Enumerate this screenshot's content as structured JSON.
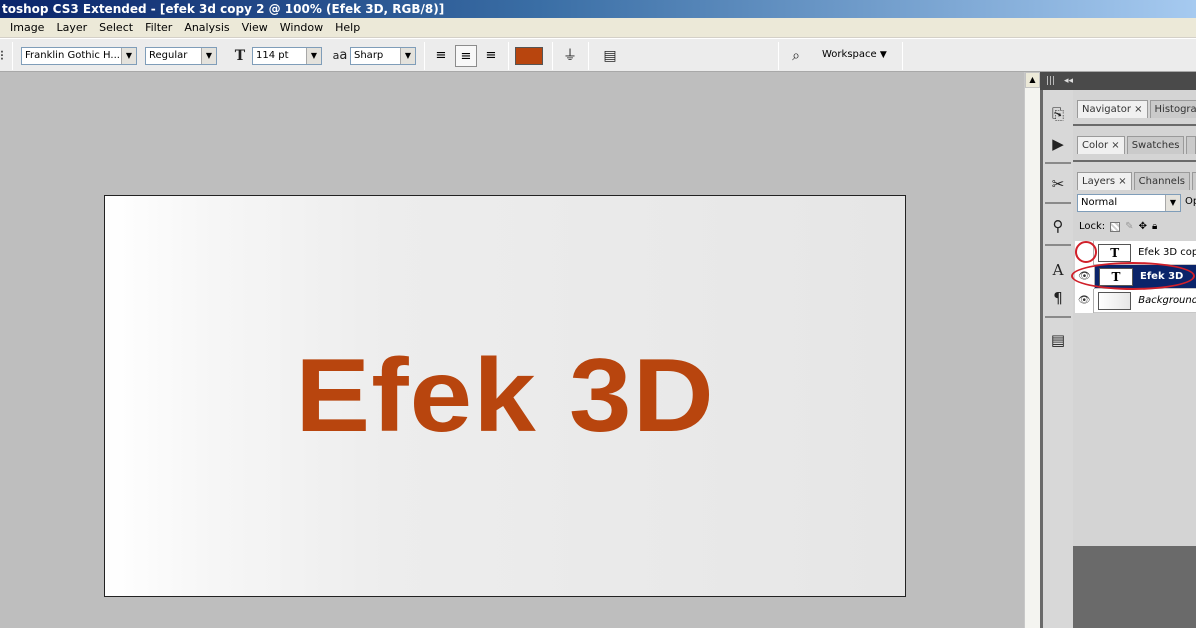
{
  "window": {
    "title": "toshop CS3 Extended - [efek 3d copy 2 @ 100% (Efek 3D, RGB/8)]"
  },
  "menu": [
    "Image",
    "Layer",
    "Select",
    "Filter",
    "Analysis",
    "View",
    "Window",
    "Help"
  ],
  "options": {
    "font_family": "Franklin Gothic H...",
    "font_style": "Regular",
    "font_size": "114 pt",
    "antialias_label": "a",
    "antialias_label2": "a",
    "antialias": "Sharp",
    "text_color": "#b8450e",
    "workspace_label": "Workspace"
  },
  "canvas": {
    "text": "Efek 3D",
    "text_color": "#b8450e"
  },
  "panels": {
    "group1_tabs": [
      "Navigator",
      "Histogra"
    ],
    "group2_tabs": [
      "Color",
      "Swatches"
    ],
    "layers_tabs": [
      "Layers",
      "Channels"
    ],
    "blend_mode": "Normal",
    "opacity_label": "Op",
    "lock_label": "Lock:",
    "layers": [
      {
        "name": "Efek 3D cop",
        "thumb": "T",
        "visible": false,
        "selected": false
      },
      {
        "name": "Efek 3D",
        "thumb": "T",
        "visible": true,
        "selected": true
      },
      {
        "name": "Background",
        "thumb": "",
        "visible": true,
        "selected": false
      }
    ]
  },
  "icons": {
    "close": "×",
    "eye": "👁",
    "dropdown": "▼",
    "collapse": "◂◂"
  }
}
